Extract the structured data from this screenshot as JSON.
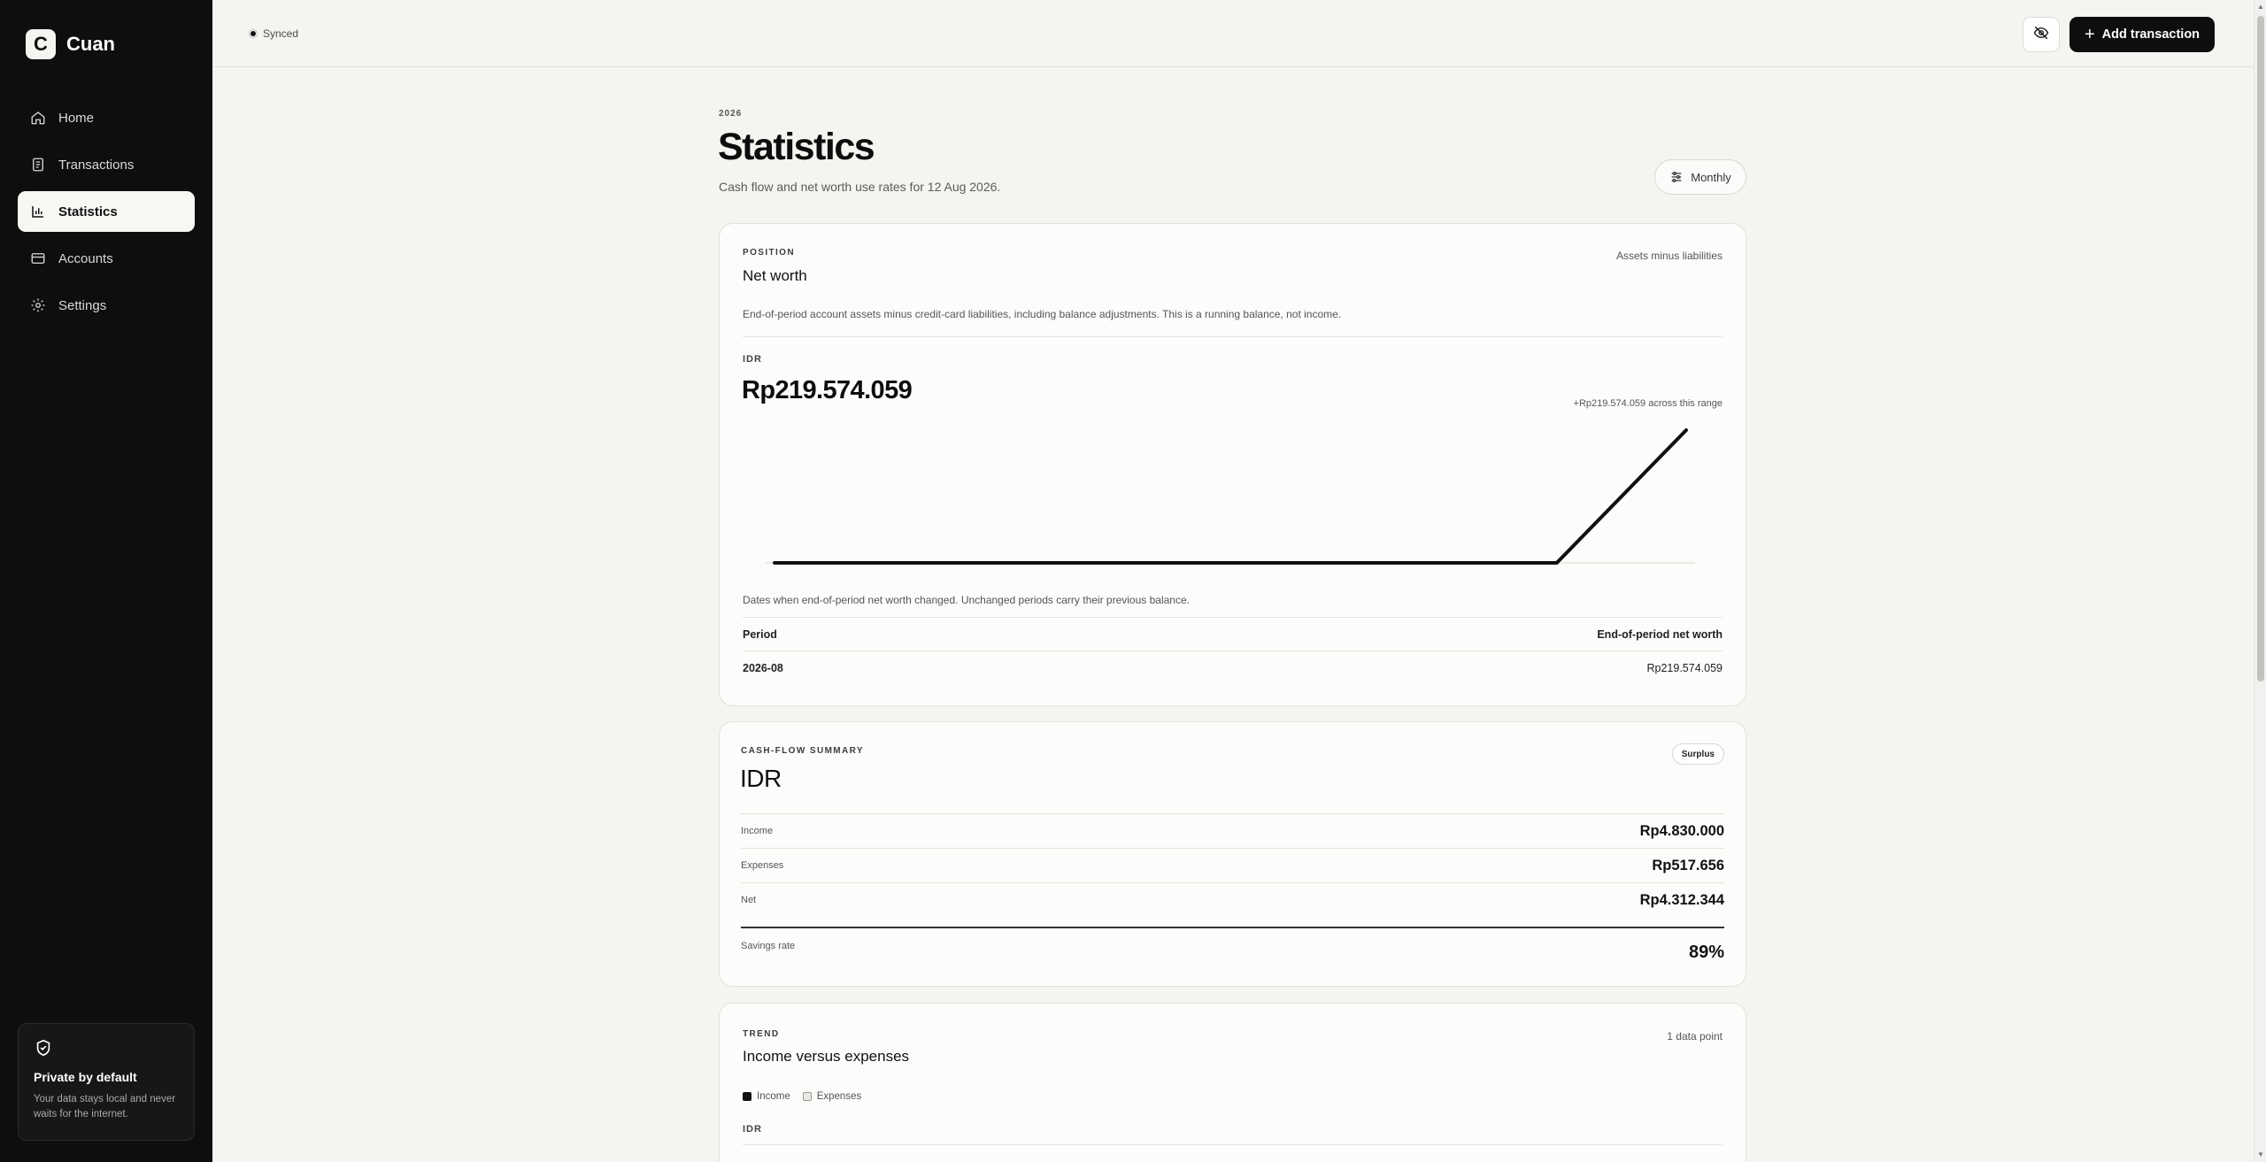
{
  "app": {
    "name": "Cuan",
    "logo_letter": "C"
  },
  "sidebar": {
    "items": [
      {
        "label": "Home",
        "icon": "home-icon",
        "active": false
      },
      {
        "label": "Transactions",
        "icon": "receipt-icon",
        "active": false
      },
      {
        "label": "Statistics",
        "icon": "bar-chart-icon",
        "active": true
      },
      {
        "label": "Accounts",
        "icon": "wallet-icon",
        "active": false
      },
      {
        "label": "Settings",
        "icon": "gear-icon",
        "active": false
      }
    ],
    "privacy": {
      "icon": "shield-check-icon",
      "title": "Private by default",
      "text": "Your data stays local and never waits for the internet."
    }
  },
  "topbar": {
    "sync_status": "Synced",
    "hide_values_icon": "eye-off-icon",
    "add_label": "Add transaction"
  },
  "header": {
    "year": "2026",
    "title": "Statistics",
    "subtitle": "Cash flow and net worth use rates for 12 Aug 2026.",
    "period_label": "Monthly",
    "period_icon": "sliders-icon"
  },
  "net_worth": {
    "eyebrow": "POSITION",
    "title": "Net worth",
    "tag": "Assets minus liabilities",
    "description": "End-of-period account assets minus credit-card liabilities, including balance adjustments. This is a running balance, not income.",
    "currency": "IDR",
    "value": "Rp219.574.059",
    "delta": "+Rp219.574.059 across this range",
    "chart_note": "Dates when end-of-period net worth changed. Unchanged periods carry their previous balance.",
    "table": {
      "headers": [
        "Period",
        "End-of-period net worth"
      ],
      "rows": [
        {
          "period": "2026-08",
          "value": "Rp219.574.059"
        }
      ]
    }
  },
  "chart_data": {
    "type": "line",
    "title": "",
    "xlabel": "",
    "ylabel": "",
    "x": [
      0,
      1
    ],
    "y": [
      0,
      219574059
    ],
    "series": [
      {
        "values": [
          0,
          0,
          219574059
        ]
      }
    ],
    "grid": false,
    "color": "#111111"
  },
  "cash_flow": {
    "eyebrow": "CASH-FLOW SUMMARY",
    "currency": "IDR",
    "badge": "Surplus",
    "rows": [
      {
        "label": "Income",
        "value": "Rp4.830.000"
      },
      {
        "label": "Expenses",
        "value": "Rp517.656"
      },
      {
        "label": "Net",
        "value": "Rp4.312.344"
      }
    ],
    "savings_rate_label": "Savings rate",
    "savings_rate_value": "89%"
  },
  "trend": {
    "eyebrow": "TREND",
    "title": "Income versus expenses",
    "tag": "1 data point",
    "legend": [
      "Income",
      "Expenses"
    ],
    "currency": "IDR"
  }
}
